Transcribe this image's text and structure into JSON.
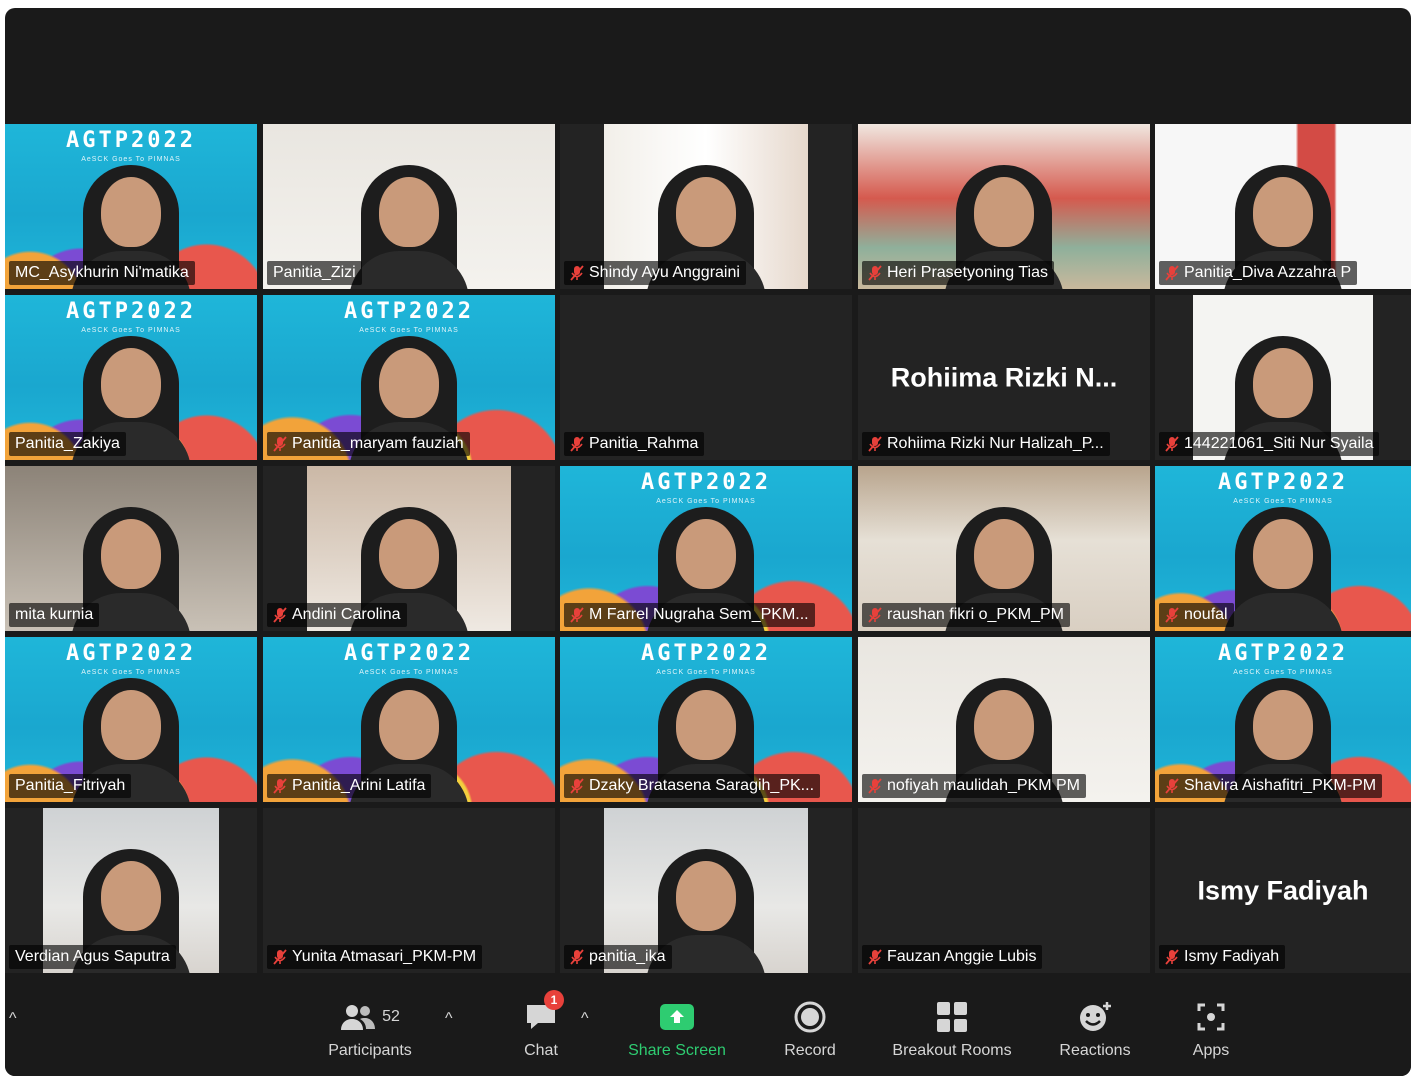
{
  "tiles": [
    {
      "name": "MC_Asykhurin Ni'matika",
      "muted": false,
      "feed": "agtp"
    },
    {
      "name": "Panitia_Zizi",
      "muted": false,
      "feed": "room2",
      "active": true
    },
    {
      "name": "Shindy Ayu Anggraini",
      "muted": true,
      "feed": "room4"
    },
    {
      "name": "Heri Prasetyoning Tias",
      "muted": true,
      "feed": "outdoor"
    },
    {
      "name": "Panitia_Diva Azzahra P",
      "muted": true,
      "feed": "redwall"
    },
    {
      "name": "Panitia_Zakiya",
      "muted": false,
      "feed": "agtp"
    },
    {
      "name": "Panitia_maryam fauziah",
      "muted": true,
      "feed": "agtp"
    },
    {
      "name": "Panitia_Rahma",
      "muted": true,
      "feed": "none"
    },
    {
      "name": "Rohiima Rizki Nur Halizah_P...",
      "muted": true,
      "feed": "none",
      "big": "Rohiima Rizki N..."
    },
    {
      "name": "144221061_Siti Nur Syaila",
      "muted": true,
      "feed": "blankw"
    },
    {
      "name": "mita kurnia",
      "muted": false,
      "feed": "dim"
    },
    {
      "name": "Andini Carolina",
      "muted": true,
      "feed": "room5"
    },
    {
      "name": "M Farrel Nugraha Sem_PKM...",
      "muted": true,
      "feed": "agtp"
    },
    {
      "name": "raushan fikri o_PKM_PM",
      "muted": true,
      "feed": "room3"
    },
    {
      "name": "noufal",
      "muted": true,
      "feed": "agtp"
    },
    {
      "name": "Panitia_Fitriyah",
      "muted": false,
      "feed": "agtp"
    },
    {
      "name": "Panitia_Arini Latifa",
      "muted": true,
      "feed": "agtp"
    },
    {
      "name": "Dzaky Bratasena Saragih_PK...",
      "muted": true,
      "feed": "agtp"
    },
    {
      "name": "nofiyah maulidah_PKM PM",
      "muted": true,
      "feed": "room2"
    },
    {
      "name": "Shavira Aishafitri_PKM-PM",
      "muted": true,
      "feed": "agtp"
    },
    {
      "name": "Verdian Agus Saputra",
      "muted": false,
      "feed": "room1"
    },
    {
      "name": "Yunita Atmasari_PKM-PM",
      "muted": true,
      "feed": "none"
    },
    {
      "name": "panitia_ika",
      "muted": true,
      "feed": "room1"
    },
    {
      "name": "Fauzan Anggie Lubis",
      "muted": true,
      "feed": "none"
    },
    {
      "name": "Ismy Fadiyah",
      "muted": true,
      "feed": "none",
      "big": "Ismy Fadiyah"
    }
  ],
  "agtp": {
    "title": "AGTP2022",
    "subtitle": "AeSCK Goes To PIMNAS"
  },
  "toolbar": {
    "participants_label": "Participants",
    "participants_count": "52",
    "chat_label": "Chat",
    "chat_badge": "1",
    "share_label": "Share Screen",
    "record_label": "Record",
    "breakout_label": "Breakout Rooms",
    "reactions_label": "Reactions",
    "apps_label": "Apps"
  },
  "colors": {
    "share": "#2ecc71",
    "active_speaker": "#e7f28a",
    "badge": "#e8413b",
    "mute": "#e8413b"
  }
}
